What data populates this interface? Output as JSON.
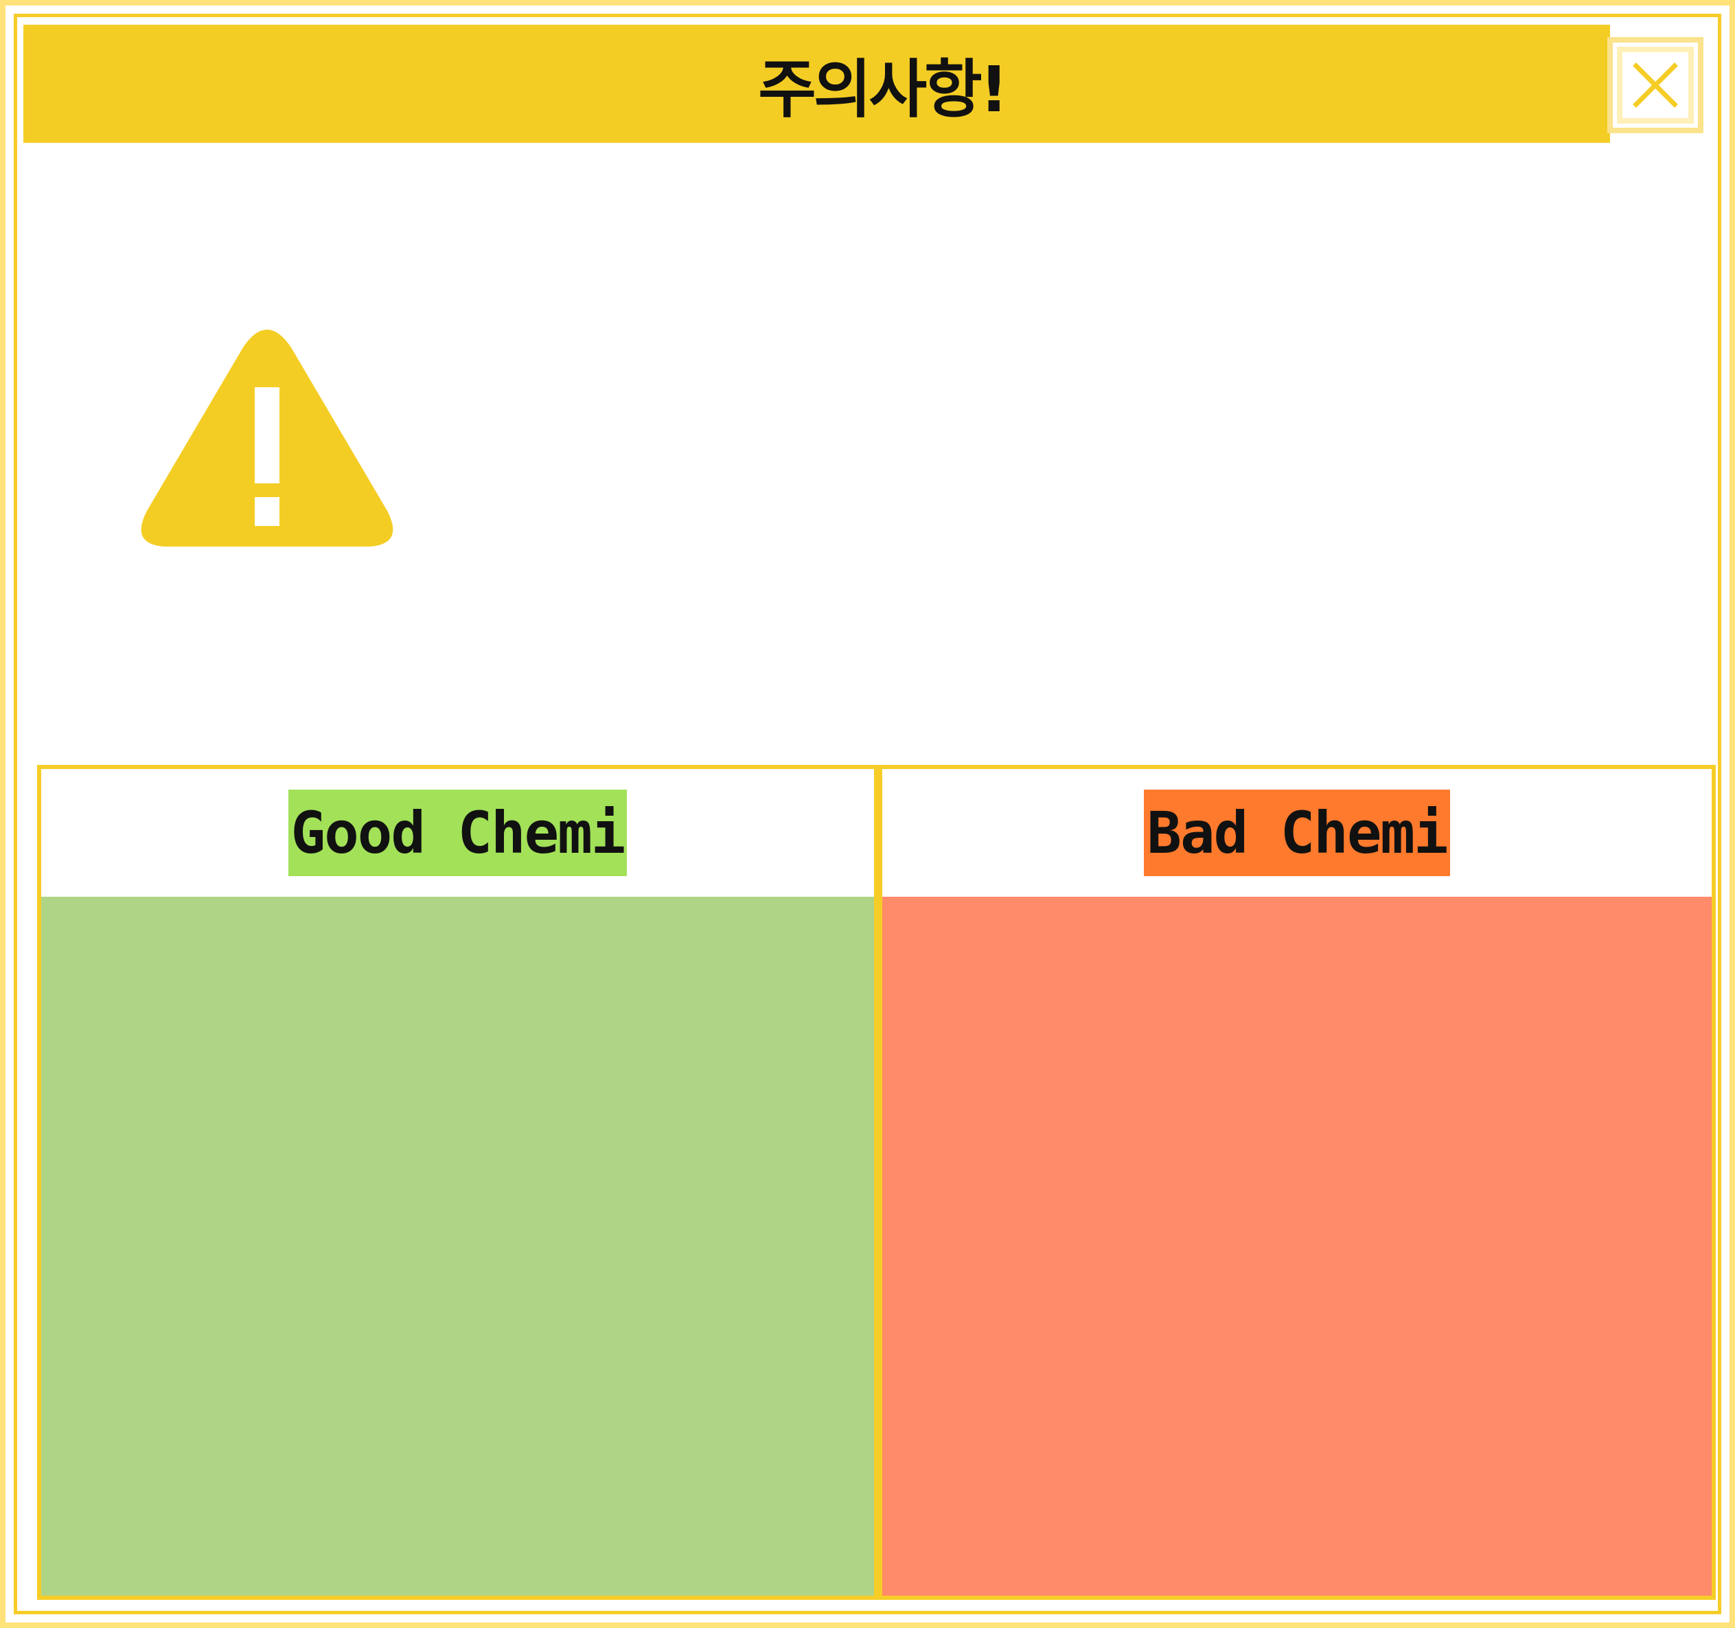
{
  "window": {
    "title": "주의사항!"
  },
  "icons": {
    "close": "close-icon",
    "warning": "warning-icon"
  },
  "colors": {
    "titlebar": "#f4cd24",
    "border": "#f6cd27",
    "good_label": "#a2e158",
    "good_area": "#b0d485",
    "bad_label": "#ff7a2c",
    "bad_area": "#ff8b6a"
  },
  "panels": {
    "good": {
      "label": "Good Chemi"
    },
    "bad": {
      "label": "Bad Chemi"
    }
  }
}
